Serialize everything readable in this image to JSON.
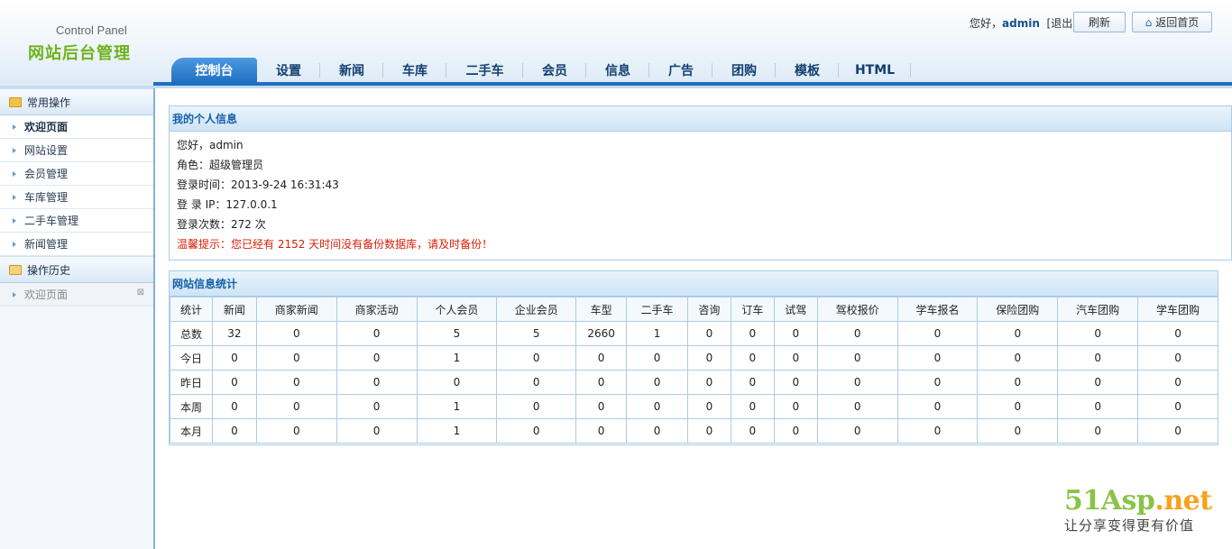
{
  "header": {
    "logo_en": "Control Panel",
    "logo_cn": "网站后台管理",
    "greeting": "您好，",
    "username": "admin",
    "logout": "[退出]",
    "refresh": "刷新",
    "home": "返回首页"
  },
  "nav": {
    "tabs": [
      "控制台",
      "设置",
      "新闻",
      "车库",
      "二手车",
      "会员",
      "信息",
      "广告",
      "团购",
      "模板",
      "HTML"
    ],
    "active": "控制台"
  },
  "sidebar": {
    "section1": "常用操作",
    "items": [
      "欢迎页面",
      "网站设置",
      "会员管理",
      "车库管理",
      "二手车管理",
      "新闻管理"
    ],
    "section2": "操作历史",
    "history": [
      "欢迎页面"
    ]
  },
  "profile": {
    "title": "我的个人信息",
    "hello": "您好，admin",
    "role": "角色：超级管理员",
    "login_time": "登录时间：2013-9-24 16:31:43",
    "login_ip": "登 录 IP：127.0.0.1",
    "login_count": "登录次数：272 次",
    "warning": "温馨提示：您已经有 2152 天时间没有备份数据库，请及时备份！"
  },
  "stats": {
    "title": "网站信息统计",
    "headers": [
      "统计",
      "新闻",
      "商家新闻",
      "商家活动",
      "个人会员",
      "企业会员",
      "车型",
      "二手车",
      "咨询",
      "订车",
      "试驾",
      "驾校报价",
      "学车报名",
      "保险团购",
      "汽车团购",
      "学车团购"
    ],
    "rows": [
      [
        "总数",
        "32",
        "0",
        "0",
        "5",
        "5",
        "2660",
        "1",
        "0",
        "0",
        "0",
        "0",
        "0",
        "0",
        "0",
        "0"
      ],
      [
        "今日",
        "0",
        "0",
        "0",
        "1",
        "0",
        "0",
        "0",
        "0",
        "0",
        "0",
        "0",
        "0",
        "0",
        "0",
        "0"
      ],
      [
        "昨日",
        "0",
        "0",
        "0",
        "0",
        "0",
        "0",
        "0",
        "0",
        "0",
        "0",
        "0",
        "0",
        "0",
        "0",
        "0"
      ],
      [
        "本周",
        "0",
        "0",
        "0",
        "1",
        "0",
        "0",
        "0",
        "0",
        "0",
        "0",
        "0",
        "0",
        "0",
        "0",
        "0"
      ],
      [
        "本月",
        "0",
        "0",
        "0",
        "1",
        "0",
        "0",
        "0",
        "0",
        "0",
        "0",
        "0",
        "0",
        "0",
        "0",
        "0"
      ]
    ]
  },
  "watermark": {
    "logo_a": "51Asp",
    "logo_b": ".net",
    "tagline": "让分享变得更有价值"
  },
  "colors": {
    "accent": "#1f6fc2",
    "logo_green": "#6fb31d",
    "warning_red": "#d81e06",
    "border": "#a9cde6"
  }
}
